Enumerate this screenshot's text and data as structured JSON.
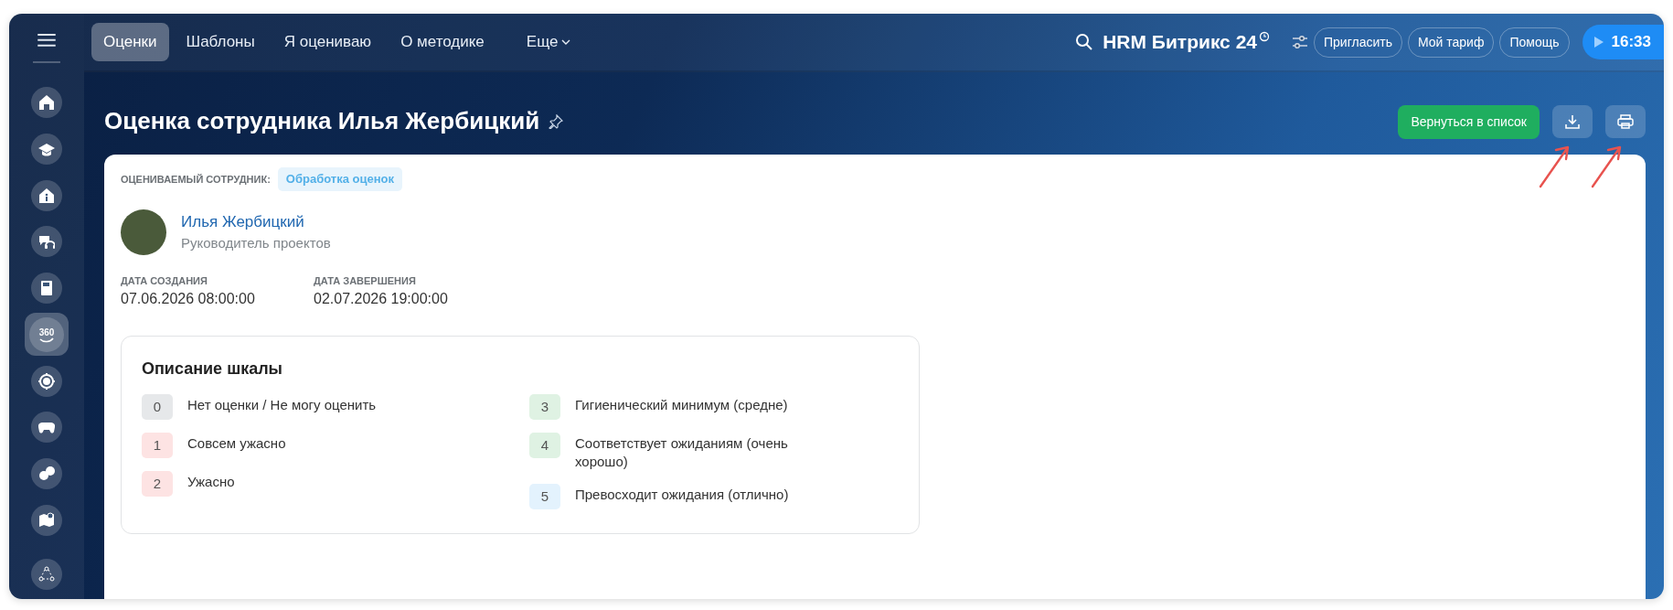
{
  "sidebar": {
    "items": [
      {
        "selected": false
      },
      {
        "selected": false
      },
      {
        "selected": false
      },
      {
        "selected": false
      },
      {
        "selected": false
      },
      {
        "selected": true,
        "label": "360"
      },
      {
        "selected": false
      },
      {
        "selected": false
      },
      {
        "selected": false
      },
      {
        "selected": false
      },
      {
        "selected": false
      }
    ]
  },
  "top_nav": {
    "tabs": [
      {
        "label": "Оценки",
        "selected": true
      },
      {
        "label": "Шаблоны",
        "selected": false
      },
      {
        "label": "Я оцениваю",
        "selected": false
      },
      {
        "label": "О методике",
        "selected": false
      }
    ],
    "more": "Еще"
  },
  "header": {
    "brand": "HRM Битрикс 24",
    "buttons": [
      "Пригласить",
      "Мой тариф",
      "Помощь"
    ],
    "time": "16:33"
  },
  "page": {
    "title": "Оценка сотрудника Илья Жербицкий",
    "back_button": "Вернуться в список"
  },
  "employee": {
    "label": "ОЦЕНИВАЕМЫЙ СОТРУДНИК:",
    "status": "Обработка оценок",
    "name": "Илья Жербицкий",
    "position": "Руководитель проектов"
  },
  "dates": [
    {
      "label": "ДАТА СОЗДАНИЯ",
      "value": "07.06.2026 08:00:00"
    },
    {
      "label": "ДАТА ЗАВЕРШЕНИЯ",
      "value": "02.07.2026 19:00:00"
    }
  ],
  "scale": {
    "title": "Описание шкалы",
    "items": [
      {
        "value": "0",
        "label": "Нет оценки / Не могу оценить",
        "color": "#e6e8ea"
      },
      {
        "value": "1",
        "label": "Совсем ужасно",
        "color": "#fde3e3"
      },
      {
        "value": "2",
        "label": "Ужасно",
        "color": "#fde3e3"
      },
      {
        "value": "3",
        "label": "Гигиенический минимум (средне)",
        "color": "#dff2e3"
      },
      {
        "value": "4",
        "label": "Соответствует ожиданиям (очень хорошо)",
        "color": "#dff2e3"
      },
      {
        "value": "5",
        "label": "Превосходит ожидания (отлично)",
        "color": "#e3f2fd"
      }
    ]
  }
}
